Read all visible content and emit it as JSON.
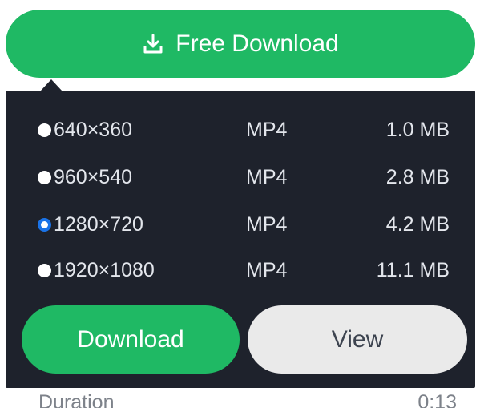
{
  "top_button": {
    "label": "Free Download",
    "icon": "download-tray-icon",
    "color": "#1fb964"
  },
  "popup": {
    "background": "#1e222c",
    "options": [
      {
        "resolution": "640×360",
        "format": "MP4",
        "size": "1.0 MB",
        "selected": false
      },
      {
        "resolution": "960×540",
        "format": "MP4",
        "size": "2.8 MB",
        "selected": false
      },
      {
        "resolution": "1280×720",
        "format": "MP4",
        "size": "4.2 MB",
        "selected": true
      },
      {
        "resolution": "1920×1080",
        "format": "MP4",
        "size": "11.1 MB",
        "selected": false
      }
    ],
    "download_label": "Download",
    "view_label": "View"
  },
  "details": {
    "duration_label": "Duration",
    "duration_value": "0:13"
  }
}
